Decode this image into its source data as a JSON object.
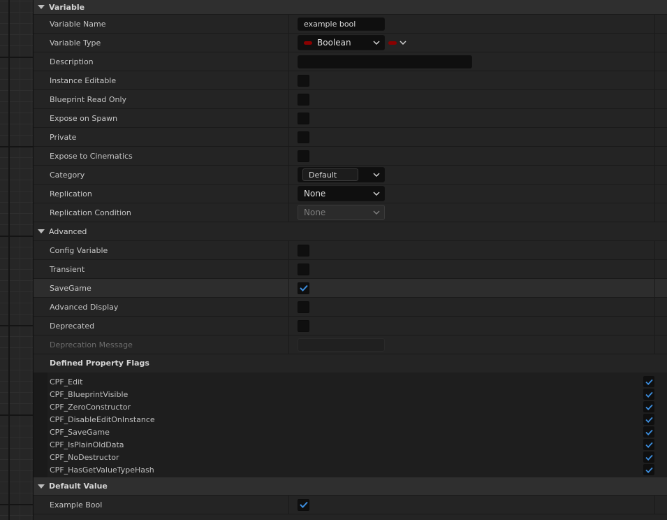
{
  "sections": {
    "variable": {
      "title": "Variable"
    },
    "advanced": {
      "title": "Advanced"
    },
    "default_value": {
      "title": "Default Value"
    }
  },
  "variable": {
    "name": {
      "label": "Variable Name",
      "value": "example bool"
    },
    "type": {
      "label": "Variable Type",
      "value": "Boolean",
      "pin_color": "#8a0000"
    },
    "description": {
      "label": "Description",
      "value": ""
    },
    "instance_editable": {
      "label": "Instance Editable",
      "checked": false
    },
    "blueprint_read_only": {
      "label": "Blueprint Read Only",
      "checked": false
    },
    "expose_on_spawn": {
      "label": "Expose on Spawn",
      "checked": false
    },
    "private": {
      "label": "Private",
      "checked": false
    },
    "expose_to_cinematics": {
      "label": "Expose to Cinematics",
      "checked": false
    },
    "category": {
      "label": "Category",
      "value": "Default"
    },
    "replication": {
      "label": "Replication",
      "value": "None"
    },
    "replication_condition": {
      "label": "Replication Condition",
      "value": "None"
    }
  },
  "advanced": {
    "config_variable": {
      "label": "Config Variable",
      "checked": false
    },
    "transient": {
      "label": "Transient",
      "checked": false
    },
    "save_game": {
      "label": "SaveGame",
      "checked": true
    },
    "advanced_display": {
      "label": "Advanced Display",
      "checked": false
    },
    "deprecated": {
      "label": "Deprecated",
      "checked": false
    },
    "deprecation_message": {
      "label": "Deprecation Message",
      "value": ""
    }
  },
  "flags": {
    "title": "Defined Property Flags",
    "items": [
      {
        "name": "CPF_Edit",
        "checked": true
      },
      {
        "name": "CPF_BlueprintVisible",
        "checked": true
      },
      {
        "name": "CPF_ZeroConstructor",
        "checked": true
      },
      {
        "name": "CPF_DisableEditOnInstance",
        "checked": true
      },
      {
        "name": "CPF_SaveGame",
        "checked": true
      },
      {
        "name": "CPF_IsPlainOldData",
        "checked": true
      },
      {
        "name": "CPF_NoDestructor",
        "checked": true
      },
      {
        "name": "CPF_HasGetValueTypeHash",
        "checked": true
      }
    ]
  },
  "default_value": {
    "example_bool": {
      "label": "Example Bool",
      "checked": true
    }
  },
  "colors": {
    "check": "#3d8fe0",
    "accent_pin": "#8a0000"
  }
}
